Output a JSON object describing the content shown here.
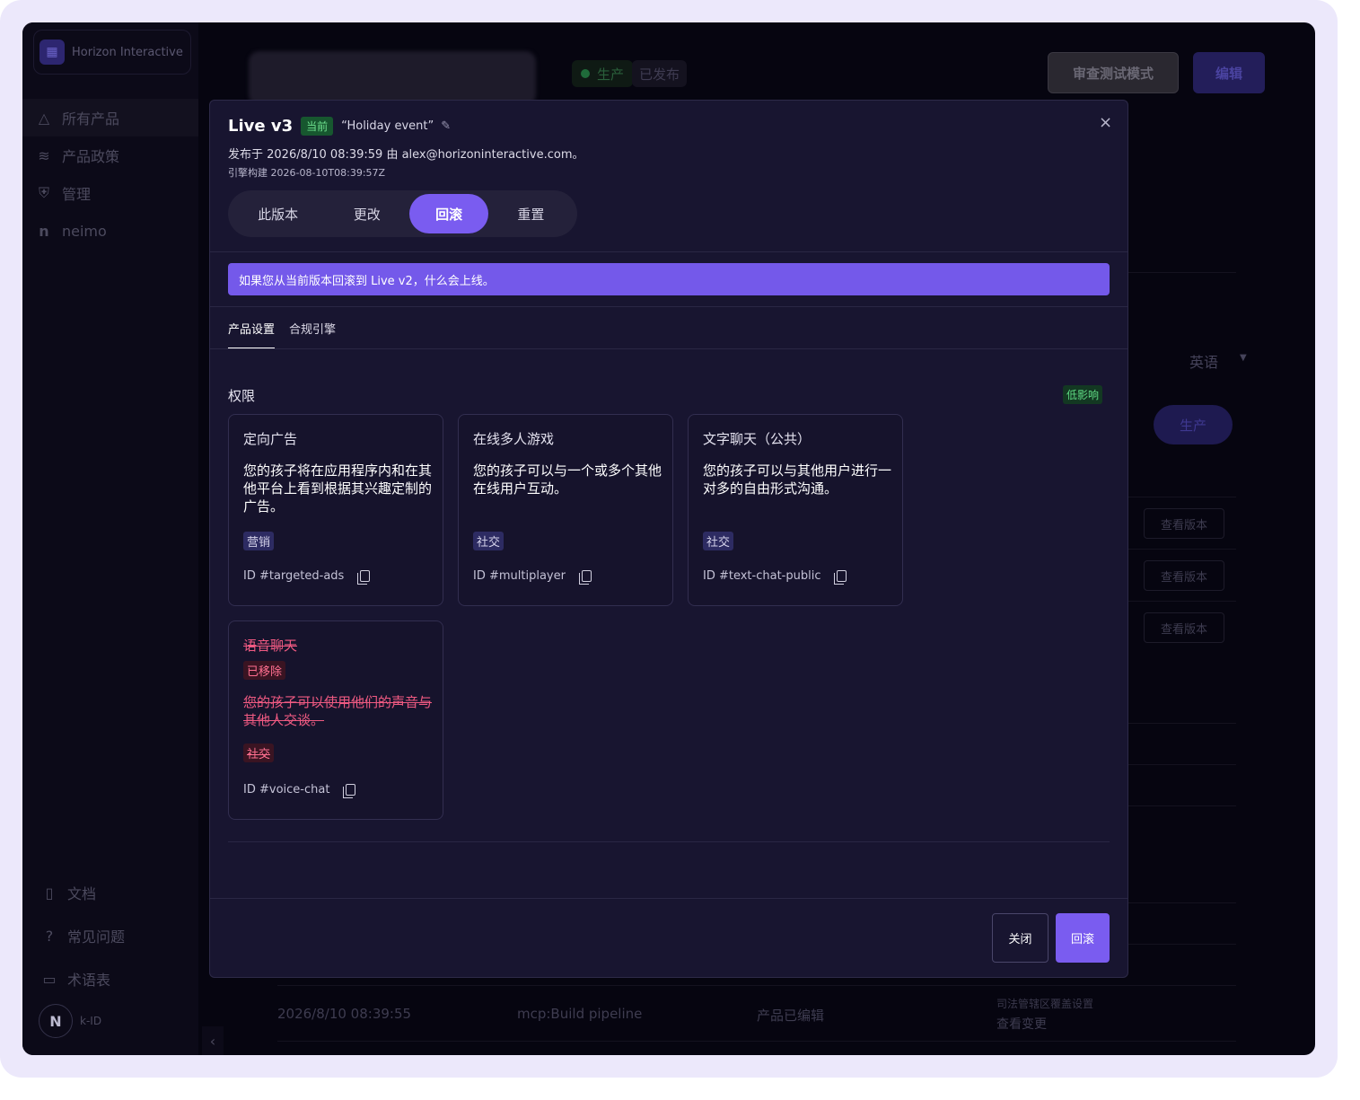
{
  "sidebar": {
    "org_name": "Horizon Interactive",
    "items": [
      {
        "label": "所有产品",
        "icon": "shapes-icon"
      },
      {
        "label": "产品政策",
        "icon": "layers-icon"
      },
      {
        "label": "管理",
        "icon": "shield-icon"
      },
      {
        "label": "neimo",
        "icon": "letter-n-icon"
      }
    ],
    "bottom_items": [
      {
        "label": "文档",
        "icon": "document-icon"
      },
      {
        "label": "常见问题",
        "icon": "question-icon"
      },
      {
        "label": "术语表",
        "icon": "book-icon"
      }
    ],
    "user_initial": "N",
    "user_name": "k-ID"
  },
  "background": {
    "status_prod": "生产",
    "status_published": "已发布",
    "review_button": "审查测试模式",
    "edit_button": "编辑",
    "language": "英语",
    "prod_pill": "生产",
    "view_version": "查看版本",
    "row": {
      "timestamp": "2026/8/10 08:39:55",
      "actor": "mcp:Build pipeline",
      "event": "产品已编辑",
      "detail": "司法管辖区覆盖设置",
      "link": "查看变更"
    }
  },
  "modal": {
    "title": "Live v3",
    "current_badge": "当前",
    "event_name": "“Holiday event”",
    "meta": "发布于 2026/8/10 08:39:59 由 alex@horizoninteractive.com。",
    "engine": "引擎构建 2026-08-10T08:39:57Z",
    "segments": [
      "此版本",
      "更改",
      "回滚",
      "重置"
    ],
    "banner": "如果您从当前版本回滚到 Live v2，什么会上线。",
    "tabs": [
      "产品设置",
      "合规引擎"
    ],
    "section_title": "权限",
    "impact_badge": "低影响",
    "cards": [
      {
        "title": "定向广告",
        "desc": "您的孩子将在应用程序内和在其他平台上看到根据其兴趣定制的广告。",
        "tag": "营销",
        "id": "ID #targeted-ads"
      },
      {
        "title": "在线多人游戏",
        "desc": "您的孩子可以与一个或多个其他在线用户互动。",
        "tag": "社交",
        "id": "ID #multiplayer"
      },
      {
        "title": "文字聊天（公共）",
        "desc": "您的孩子可以与其他用户进行一对多的自由形式沟通。",
        "tag": "社交",
        "id": "ID #text-chat-public"
      }
    ],
    "removed_card": {
      "title": "语音聊天",
      "badge": "已移除",
      "desc": "您的孩子可以使用他们的声音与其他人交谈。",
      "tag": "社交",
      "id": "ID #voice-chat"
    },
    "close_button": "关闭",
    "rollback_button": "回滚"
  }
}
